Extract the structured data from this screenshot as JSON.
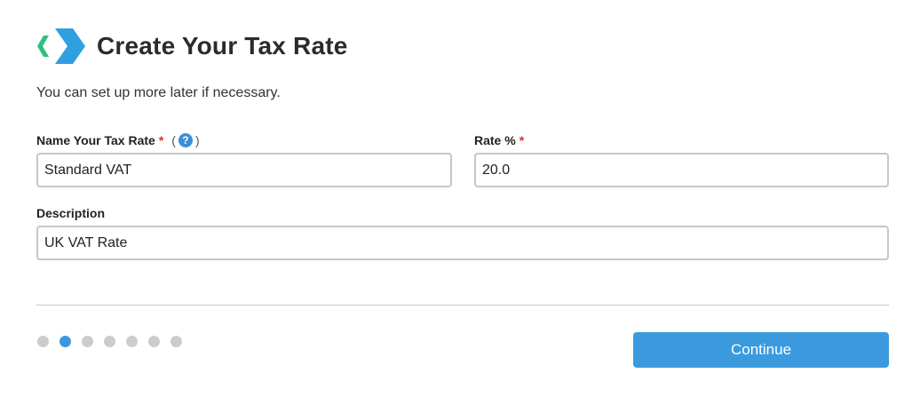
{
  "header": {
    "title": "Create Your Tax Rate",
    "logo_icon": "chevron-logo-icon",
    "logo_colors": [
      "#3aa8e0",
      "#2fbf7f"
    ]
  },
  "subtitle": "You can set up more later if necessary.",
  "form": {
    "name": {
      "label": "Name Your Tax Rate",
      "required_marker": "*",
      "help_open": "(",
      "help_glyph": "?",
      "help_close": ")",
      "value": "Standard VAT"
    },
    "rate": {
      "label": "Rate %",
      "required_marker": "*",
      "value": "20.0"
    },
    "description": {
      "label": "Description",
      "value": "UK VAT Rate"
    }
  },
  "pagination": {
    "total_steps": 7,
    "current_step": 2
  },
  "actions": {
    "continue_label": "Continue"
  },
  "colors": {
    "accent": "#3b9ade",
    "required": "#d9302c",
    "dot_inactive": "#cccccc"
  }
}
